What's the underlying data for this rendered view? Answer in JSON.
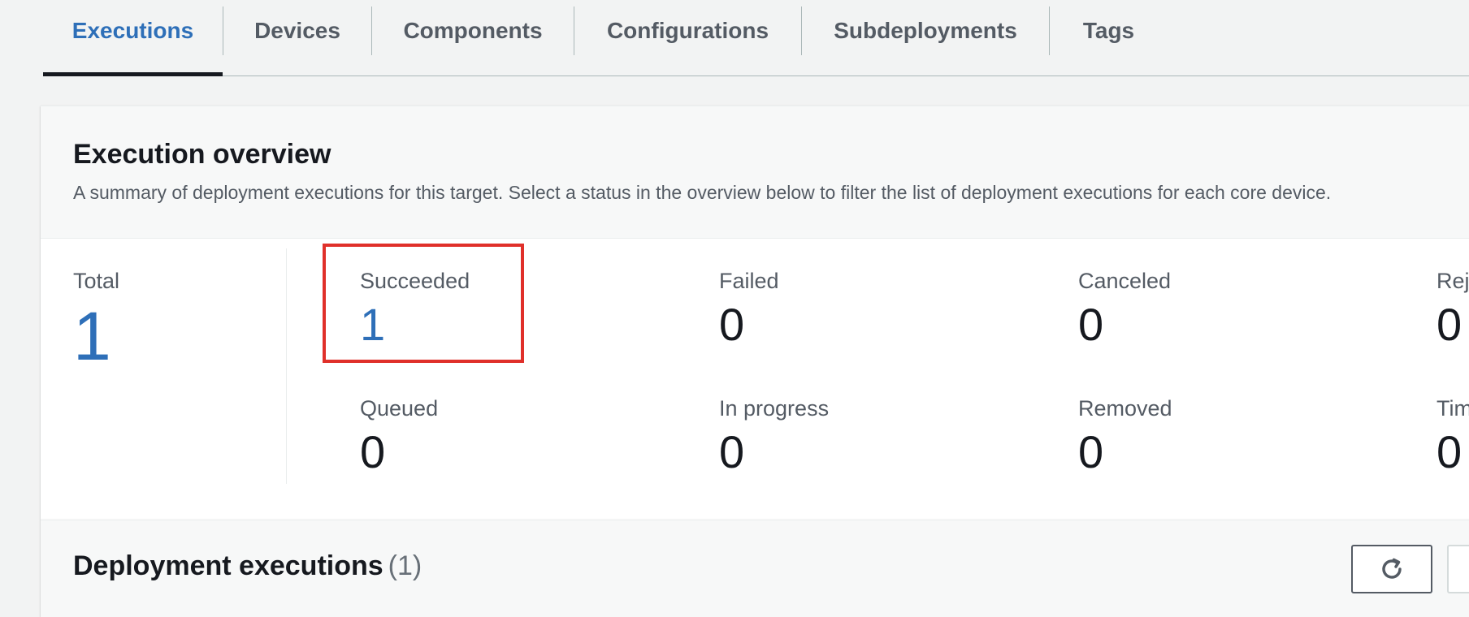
{
  "tabs": {
    "items": [
      {
        "label": "Executions",
        "active": true
      },
      {
        "label": "Devices",
        "active": false
      },
      {
        "label": "Components",
        "active": false
      },
      {
        "label": "Configurations",
        "active": false
      },
      {
        "label": "Subdeployments",
        "active": false
      },
      {
        "label": "Tags",
        "active": false
      }
    ]
  },
  "overview": {
    "title": "Execution overview",
    "description": "A summary of deployment executions for this target. Select a status in the overview below to filter the list of deployment executions for each core device.",
    "total": {
      "label": "Total",
      "value": "1"
    },
    "stats": {
      "succeeded": {
        "label": "Succeeded",
        "value": "1"
      },
      "failed": {
        "label": "Failed",
        "value": "0"
      },
      "canceled": {
        "label": "Canceled",
        "value": "0"
      },
      "rejected": {
        "label": "Rej",
        "value": "0"
      },
      "queued": {
        "label": "Queued",
        "value": "0"
      },
      "in_progress": {
        "label": "In progress",
        "value": "0"
      },
      "removed": {
        "label": "Removed",
        "value": "0"
      },
      "timed_out": {
        "label": "Tim",
        "value": "0"
      }
    }
  },
  "deployment_executions": {
    "title": "Deployment executions",
    "count": "(1)",
    "refresh_icon": "refresh-icon"
  },
  "colors": {
    "accent": "#2e6fb8",
    "highlight": "#e0302a",
    "text": "#16191f",
    "muted": "#545b64",
    "background": "#f2f3f3"
  }
}
